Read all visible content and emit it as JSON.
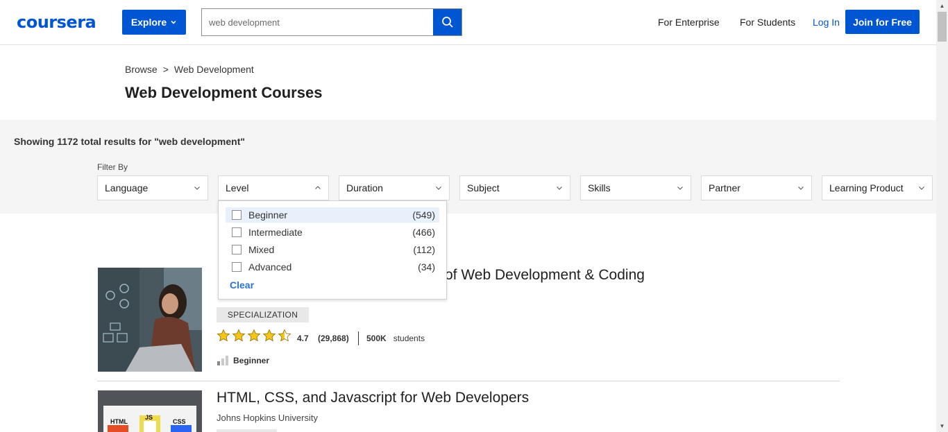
{
  "header": {
    "logo": "coursera",
    "explore_label": "Explore",
    "search_value": "web development",
    "nav": {
      "enterprise": "For Enterprise",
      "students": "For Students",
      "login": "Log In",
      "join": "Join for Free"
    }
  },
  "breadcrumb": {
    "root": "Browse",
    "separator": ">",
    "current": "Web Development"
  },
  "page_title": "Web Development Courses",
  "results_text": "Showing 1172 total results for \"web development\"",
  "filters": {
    "label": "Filter By",
    "items": [
      "Language",
      "Level",
      "Duration",
      "Subject",
      "Skills",
      "Partner",
      "Learning Product"
    ]
  },
  "level_menu": {
    "options": [
      {
        "label": "Beginner",
        "count": "(549)",
        "checked": false
      },
      {
        "label": "Intermediate",
        "count": "(466)",
        "checked": false
      },
      {
        "label": "Mixed",
        "count": "(112)",
        "checked": false
      },
      {
        "label": "Advanced",
        "count": "(34)",
        "checked": false
      }
    ],
    "clear": "Clear"
  },
  "results": [
    {
      "title_visible": "of Web Development & Coding",
      "type": "SPECIALIZATION",
      "rating": "4.7",
      "stars": 4.5,
      "reviews": "(29,868)",
      "enrollment": "500K",
      "enrollment_suffix": "students",
      "level": "Beginner"
    },
    {
      "title": "HTML, CSS, and Javascript for Web Developers",
      "partner": "Johns Hopkins University",
      "thumb_labels": [
        "HTML",
        "JS",
        "CSS"
      ]
    }
  ],
  "colors": {
    "brand_blue": "#0056d2",
    "star_gold": "#f5c518",
    "link_blue": "#2a73cc"
  }
}
